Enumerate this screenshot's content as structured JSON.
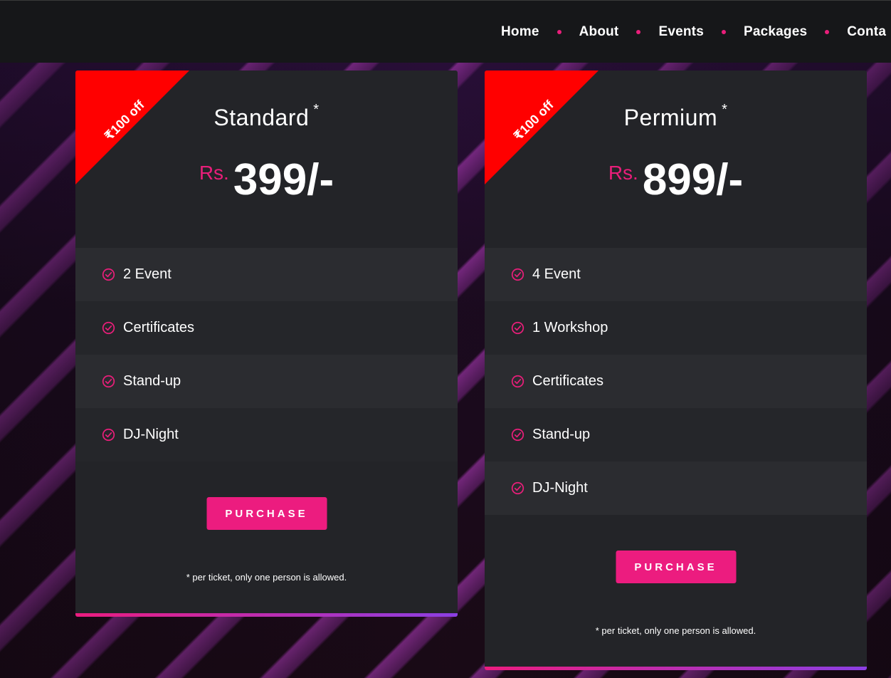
{
  "nav": {
    "items": [
      {
        "label": "Home"
      },
      {
        "label": "About"
      },
      {
        "label": "Events"
      },
      {
        "label": "Packages"
      },
      {
        "label": "Conta"
      }
    ]
  },
  "cards": [
    {
      "ribbon": "₹100 off",
      "title": "Standard",
      "asterisk": "*",
      "currency": "Rs.",
      "price": "399/-",
      "features": [
        "2 Event",
        "Certificates",
        "Stand-up",
        "DJ-Night"
      ],
      "button": "PURCHASE",
      "note": "* per ticket, only one person is allowed."
    },
    {
      "ribbon": "₹100 off",
      "title": "Permium",
      "asterisk": "*",
      "currency": "Rs.",
      "price": "899/-",
      "features": [
        "4 Event",
        "1 Workshop",
        "Certificates",
        "Stand-up",
        "DJ-Night"
      ],
      "button": "PURCHASE",
      "note": "* per ticket, only one person is allowed."
    }
  ],
  "colors": {
    "accent": "#e91e7a",
    "ribbon": "#ff0000",
    "card": "#232428",
    "navbar": "#161719"
  },
  "icons": {
    "feature": "check-circle-icon"
  }
}
